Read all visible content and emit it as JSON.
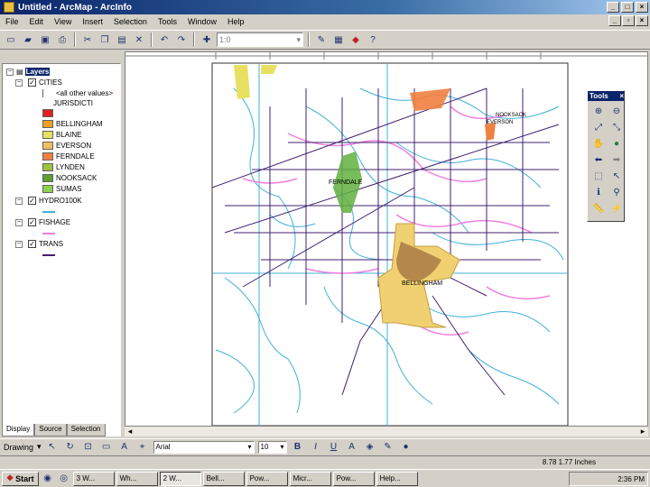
{
  "window": {
    "title": "Untitled - ArcMap - ArcInfo"
  },
  "menu": [
    "File",
    "Edit",
    "View",
    "Insert",
    "Selection",
    "Tools",
    "Window",
    "Help"
  ],
  "toolbar": {
    "scale_value": "1:0"
  },
  "toc": {
    "root": "Layers",
    "layers": [
      {
        "name": "CITIES",
        "checked": true
      },
      {
        "name": "<all other values>",
        "sub": true
      },
      {
        "name": "JURISDICTI",
        "sub": true
      }
    ],
    "classes": [
      {
        "label": "",
        "color": "#e02020"
      },
      {
        "label": "BELLINGHAM",
        "color": "#f0a020"
      },
      {
        "label": "BLAINE",
        "color": "#e8e060"
      },
      {
        "label": "EVERSON",
        "color": "#f0c060"
      },
      {
        "label": "FERNDALE",
        "color": "#f08040"
      },
      {
        "label": "LYNDEN",
        "color": "#a0c040"
      },
      {
        "label": "NOOKSACK",
        "color": "#60a030"
      },
      {
        "label": "SUMAS",
        "color": "#90d050"
      }
    ],
    "more_layers": [
      {
        "name": "HYDRO100K",
        "checked": true
      },
      {
        "name": "FISHAGE",
        "checked": true
      },
      {
        "name": "TRANS",
        "checked": true
      }
    ],
    "tabs": [
      "Display",
      "Source",
      "Selection"
    ]
  },
  "map": {
    "labels": {
      "ferndale": "FERNDALE",
      "bellingham": "BELLINGHAM",
      "everson": "EVERSON",
      "nooksack": "NOOKSACK"
    },
    "colors": {
      "water": "#40b0d8",
      "roads": "#402070",
      "fish": "#f080e0",
      "city": "#f0d070",
      "ferndale": "#60b040",
      "urban": "#a07040"
    }
  },
  "tools_panel": {
    "title": "Tools"
  },
  "drawing": {
    "label": "Drawing",
    "font": "Arial",
    "size": "10"
  },
  "status": {
    "coords": "8.78  1.77 Inches"
  },
  "taskbar": {
    "start": "Start",
    "tasks": [
      "3 W...",
      "Wh...",
      "2 W...",
      "Bell...",
      "Pow...",
      "Micr...",
      "Pow...",
      "Help..."
    ],
    "clock": "2:36 PM"
  }
}
